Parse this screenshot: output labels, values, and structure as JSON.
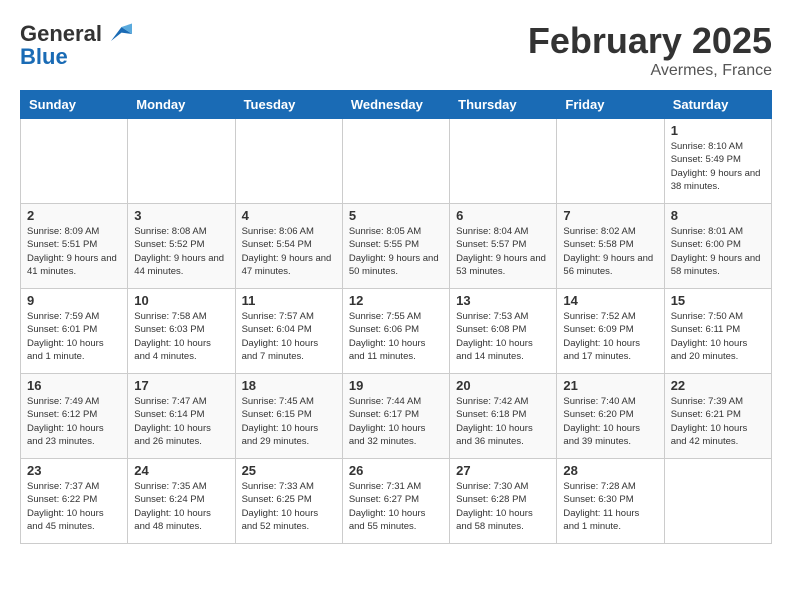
{
  "header": {
    "logo_line1": "General",
    "logo_line2": "Blue",
    "month": "February 2025",
    "location": "Avermes, France"
  },
  "weekdays": [
    "Sunday",
    "Monday",
    "Tuesday",
    "Wednesday",
    "Thursday",
    "Friday",
    "Saturday"
  ],
  "weeks": [
    [
      {
        "day": "",
        "info": ""
      },
      {
        "day": "",
        "info": ""
      },
      {
        "day": "",
        "info": ""
      },
      {
        "day": "",
        "info": ""
      },
      {
        "day": "",
        "info": ""
      },
      {
        "day": "",
        "info": ""
      },
      {
        "day": "1",
        "info": "Sunrise: 8:10 AM\nSunset: 5:49 PM\nDaylight: 9 hours and 38 minutes."
      }
    ],
    [
      {
        "day": "2",
        "info": "Sunrise: 8:09 AM\nSunset: 5:51 PM\nDaylight: 9 hours and 41 minutes."
      },
      {
        "day": "3",
        "info": "Sunrise: 8:08 AM\nSunset: 5:52 PM\nDaylight: 9 hours and 44 minutes."
      },
      {
        "day": "4",
        "info": "Sunrise: 8:06 AM\nSunset: 5:54 PM\nDaylight: 9 hours and 47 minutes."
      },
      {
        "day": "5",
        "info": "Sunrise: 8:05 AM\nSunset: 5:55 PM\nDaylight: 9 hours and 50 minutes."
      },
      {
        "day": "6",
        "info": "Sunrise: 8:04 AM\nSunset: 5:57 PM\nDaylight: 9 hours and 53 minutes."
      },
      {
        "day": "7",
        "info": "Sunrise: 8:02 AM\nSunset: 5:58 PM\nDaylight: 9 hours and 56 minutes."
      },
      {
        "day": "8",
        "info": "Sunrise: 8:01 AM\nSunset: 6:00 PM\nDaylight: 9 hours and 58 minutes."
      }
    ],
    [
      {
        "day": "9",
        "info": "Sunrise: 7:59 AM\nSunset: 6:01 PM\nDaylight: 10 hours and 1 minute."
      },
      {
        "day": "10",
        "info": "Sunrise: 7:58 AM\nSunset: 6:03 PM\nDaylight: 10 hours and 4 minutes."
      },
      {
        "day": "11",
        "info": "Sunrise: 7:57 AM\nSunset: 6:04 PM\nDaylight: 10 hours and 7 minutes."
      },
      {
        "day": "12",
        "info": "Sunrise: 7:55 AM\nSunset: 6:06 PM\nDaylight: 10 hours and 11 minutes."
      },
      {
        "day": "13",
        "info": "Sunrise: 7:53 AM\nSunset: 6:08 PM\nDaylight: 10 hours and 14 minutes."
      },
      {
        "day": "14",
        "info": "Sunrise: 7:52 AM\nSunset: 6:09 PM\nDaylight: 10 hours and 17 minutes."
      },
      {
        "day": "15",
        "info": "Sunrise: 7:50 AM\nSunset: 6:11 PM\nDaylight: 10 hours and 20 minutes."
      }
    ],
    [
      {
        "day": "16",
        "info": "Sunrise: 7:49 AM\nSunset: 6:12 PM\nDaylight: 10 hours and 23 minutes."
      },
      {
        "day": "17",
        "info": "Sunrise: 7:47 AM\nSunset: 6:14 PM\nDaylight: 10 hours and 26 minutes."
      },
      {
        "day": "18",
        "info": "Sunrise: 7:45 AM\nSunset: 6:15 PM\nDaylight: 10 hours and 29 minutes."
      },
      {
        "day": "19",
        "info": "Sunrise: 7:44 AM\nSunset: 6:17 PM\nDaylight: 10 hours and 32 minutes."
      },
      {
        "day": "20",
        "info": "Sunrise: 7:42 AM\nSunset: 6:18 PM\nDaylight: 10 hours and 36 minutes."
      },
      {
        "day": "21",
        "info": "Sunrise: 7:40 AM\nSunset: 6:20 PM\nDaylight: 10 hours and 39 minutes."
      },
      {
        "day": "22",
        "info": "Sunrise: 7:39 AM\nSunset: 6:21 PM\nDaylight: 10 hours and 42 minutes."
      }
    ],
    [
      {
        "day": "23",
        "info": "Sunrise: 7:37 AM\nSunset: 6:22 PM\nDaylight: 10 hours and 45 minutes."
      },
      {
        "day": "24",
        "info": "Sunrise: 7:35 AM\nSunset: 6:24 PM\nDaylight: 10 hours and 48 minutes."
      },
      {
        "day": "25",
        "info": "Sunrise: 7:33 AM\nSunset: 6:25 PM\nDaylight: 10 hours and 52 minutes."
      },
      {
        "day": "26",
        "info": "Sunrise: 7:31 AM\nSunset: 6:27 PM\nDaylight: 10 hours and 55 minutes."
      },
      {
        "day": "27",
        "info": "Sunrise: 7:30 AM\nSunset: 6:28 PM\nDaylight: 10 hours and 58 minutes."
      },
      {
        "day": "28",
        "info": "Sunrise: 7:28 AM\nSunset: 6:30 PM\nDaylight: 11 hours and 1 minute."
      },
      {
        "day": "",
        "info": ""
      }
    ]
  ]
}
